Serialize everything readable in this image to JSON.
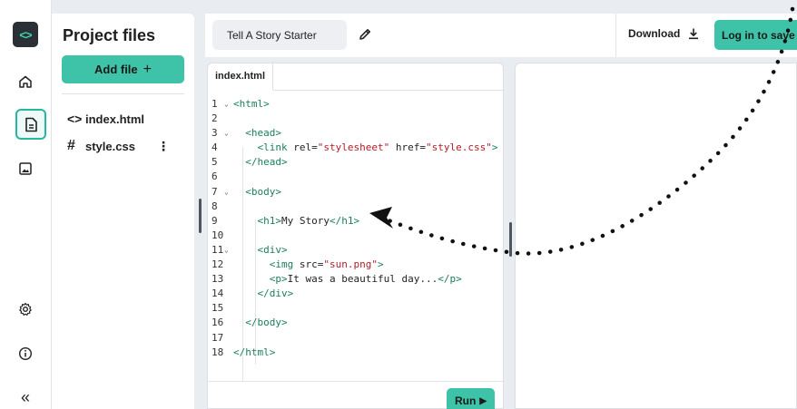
{
  "sidebar": {
    "logo_icon": "code-brackets-icon",
    "items": [
      {
        "name": "home",
        "icon": "home-icon"
      },
      {
        "name": "project-files",
        "icon": "file-icon",
        "active": true
      },
      {
        "name": "images",
        "icon": "image-icon"
      },
      {
        "name": "settings",
        "icon": "gear-icon"
      },
      {
        "name": "info",
        "icon": "info-icon"
      },
      {
        "name": "collapse",
        "icon": "double-chevron-left-icon",
        "glyph": "«"
      }
    ]
  },
  "files_panel": {
    "title": "Project files",
    "add_file_label": "Add file",
    "add_file_glyph": "+",
    "files": [
      {
        "name": "index.html",
        "icon_glyph": "<>"
      },
      {
        "name": "style.css",
        "icon_glyph": "#",
        "menu_glyph": "⋮"
      }
    ]
  },
  "topbar": {
    "project_name": "Tell A Story Starter",
    "download_label": "Download",
    "login_label": "Log in to save"
  },
  "editor": {
    "tab_label": "index.html",
    "run_label": "Run",
    "run_glyph": "▶",
    "lines": [
      {
        "n": "1",
        "fold": true,
        "code": "<html>"
      },
      {
        "n": "2",
        "code": ""
      },
      {
        "n": "3",
        "fold": true,
        "code": "  <head>"
      },
      {
        "n": "4",
        "code": "    <link rel=\"stylesheet\" href=\"style.css\">"
      },
      {
        "n": "5",
        "code": "  </head>"
      },
      {
        "n": "6",
        "code": ""
      },
      {
        "n": "7",
        "fold": true,
        "code": "  <body>"
      },
      {
        "n": "8",
        "code": ""
      },
      {
        "n": "9",
        "code": "    <h1>My Story</h1>"
      },
      {
        "n": "10",
        "code": ""
      },
      {
        "n": "11",
        "fold": true,
        "code": "    <div>"
      },
      {
        "n": "12",
        "code": "      <img src=\"sun.png\">"
      },
      {
        "n": "13",
        "code": "      <p>It was a beautiful day...</p>"
      },
      {
        "n": "14",
        "code": "    </div>"
      },
      {
        "n": "15",
        "code": ""
      },
      {
        "n": "16",
        "code": "  </body>"
      },
      {
        "n": "17",
        "code": ""
      },
      {
        "n": "18",
        "code": "</html>"
      }
    ]
  },
  "colors": {
    "accent": "#3fc3a8",
    "tag": "#1a7f5a",
    "string": "#b31d28",
    "background": "#e9ecf1"
  }
}
